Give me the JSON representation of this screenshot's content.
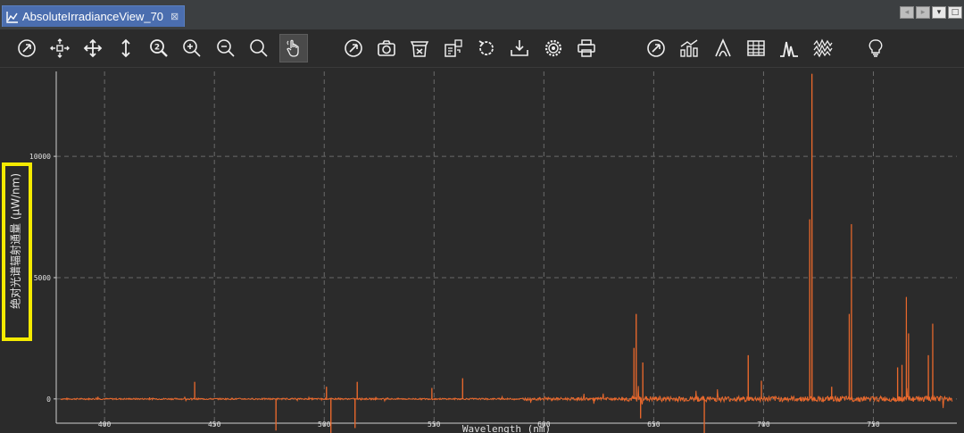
{
  "window": {
    "tab_title": "AbsoluteIrradianceView_70",
    "tab_close": "⊠",
    "controls": [
      "◂",
      "▸",
      "▾",
      "□"
    ]
  },
  "toolbar": {
    "groups": [
      [
        "reset-view-icon",
        "pan-all-directions-icon",
        "move-icon",
        "vertical-resize-icon",
        "zoom-2x-icon",
        "zoom-in-icon",
        "zoom-out-icon",
        "zoom-fit-icon",
        "hand-pointer-icon"
      ],
      [
        "reset-view-2-icon",
        "camera-icon",
        "clear-basket-icon",
        "export-data-icon",
        "refresh-icon",
        "download-tray-icon",
        "settings-gear-icon",
        "print-icon"
      ],
      [
        "reset-view-3-icon",
        "bar-chart-icon",
        "peak-icon",
        "table-icon",
        "spectrum-peaks-icon",
        "wave-pattern-icon",
        "lightbulb-icon"
      ]
    ],
    "active": "hand-pointer-icon"
  },
  "chart_data": {
    "type": "line",
    "title": "",
    "xlabel": "Wavelength (nm)",
    "ylabel": "绝对光谱辐射通量 (μW/nm)",
    "xlim": [
      378,
      788
    ],
    "ylim": [
      -1000,
      13500
    ],
    "x_ticks": [
      400,
      450,
      500,
      550,
      600,
      650,
      700,
      750
    ],
    "y_ticks": [
      0,
      5000,
      10000
    ],
    "grid": true,
    "line_color": "#e8682c",
    "peaks": [
      {
        "x": 441,
        "y": 700
      },
      {
        "x": 478,
        "y": -1300
      },
      {
        "x": 501,
        "y": 500
      },
      {
        "x": 503,
        "y": -1400
      },
      {
        "x": 515,
        "y": 700
      },
      {
        "x": 514,
        "y": -1200
      },
      {
        "x": 549,
        "y": 450
      },
      {
        "x": 563,
        "y": 850
      },
      {
        "x": 642,
        "y": 3500
      },
      {
        "x": 641,
        "y": 2100
      },
      {
        "x": 645,
        "y": 1500
      },
      {
        "x": 644,
        "y": -800
      },
      {
        "x": 673,
        "y": -1500
      },
      {
        "x": 693,
        "y": 1800
      },
      {
        "x": 699,
        "y": 750
      },
      {
        "x": 722,
        "y": 13400
      },
      {
        "x": 721,
        "y": 7400
      },
      {
        "x": 731,
        "y": 500
      },
      {
        "x": 740,
        "y": 7200
      },
      {
        "x": 739,
        "y": 3500
      },
      {
        "x": 761,
        "y": 1300
      },
      {
        "x": 765,
        "y": 4200
      },
      {
        "x": 763,
        "y": 1400
      },
      {
        "x": 766,
        "y": 2700
      },
      {
        "x": 777,
        "y": 3100
      },
      {
        "x": 775,
        "y": 1800
      }
    ]
  }
}
